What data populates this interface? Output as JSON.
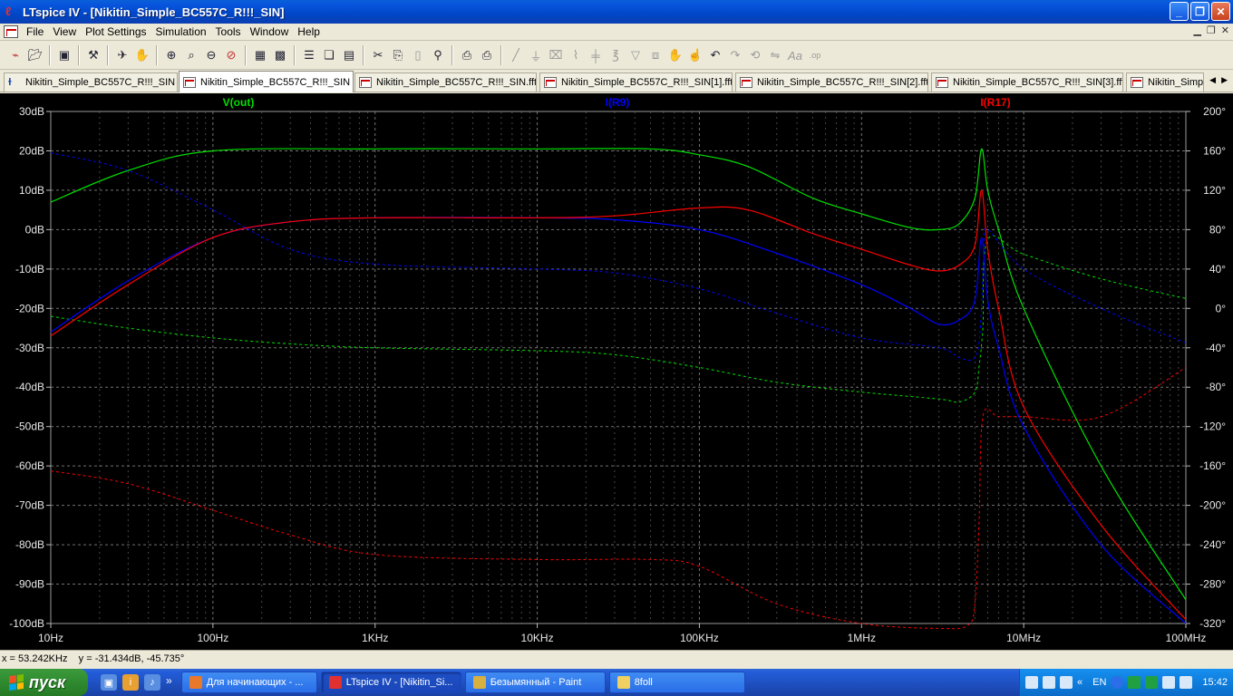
{
  "window": {
    "title": "LTspice IV - [Nikitin_Simple_BC557C_R!!!_SIN]",
    "minimize": "_",
    "maximize": "❐",
    "close": "✕"
  },
  "menu": [
    "File",
    "View",
    "Plot Settings",
    "Simulation",
    "Tools",
    "Window",
    "Help"
  ],
  "tabs": [
    {
      "label": "Nikitin_Simple_BC557C_R!!!_SIN",
      "type": "schematic",
      "active": false
    },
    {
      "label": "Nikitin_Simple_BC557C_R!!!_SIN",
      "type": "plot",
      "active": true
    },
    {
      "label": "Nikitin_Simple_BC557C_R!!!_SIN.fft",
      "type": "plot",
      "active": false
    },
    {
      "label": "Nikitin_Simple_BC557C_R!!!_SIN[1].fft",
      "type": "plot",
      "active": false
    },
    {
      "label": "Nikitin_Simple_BC557C_R!!!_SIN[2].fft",
      "type": "plot",
      "active": false
    },
    {
      "label": "Nikitin_Simple_BC557C_R!!!_SIN[3].fft",
      "type": "plot",
      "active": false
    },
    {
      "label": "Nikitin_Simp",
      "type": "plot",
      "active": false
    }
  ],
  "chart_data": {
    "type": "line",
    "xscale": "log",
    "xlim": [
      10,
      100000000
    ],
    "x_ticks": [
      {
        "v": 10,
        "label": "10Hz"
      },
      {
        "v": 100,
        "label": "100Hz"
      },
      {
        "v": 1000,
        "label": "1KHz"
      },
      {
        "v": 10000,
        "label": "10KHz"
      },
      {
        "v": 100000,
        "label": "100KHz"
      },
      {
        "v": 1000000,
        "label": "1MHz"
      },
      {
        "v": 10000000,
        "label": "10MHz"
      },
      {
        "v": 100000000,
        "label": "100MHz"
      }
    ],
    "ylim": [
      -100,
      30
    ],
    "y_ticks": [
      "30dB",
      "20dB",
      "10dB",
      "0dB",
      "-10dB",
      "-20dB",
      "-30dB",
      "-40dB",
      "-50dB",
      "-60dB",
      "-70dB",
      "-80dB",
      "-90dB",
      "-100dB"
    ],
    "y2lim": [
      -320,
      200
    ],
    "y2_ticks": [
      "200°",
      "160°",
      "120°",
      "80°",
      "40°",
      "0°",
      "-40°",
      "-80°",
      "-120°",
      "-160°",
      "-200°",
      "-240°",
      "-280°",
      "-320°"
    ],
    "grid": true,
    "legend_position": "top",
    "series": [
      {
        "name": "V(out)",
        "color": "#00e000",
        "magnitude": [
          [
            10,
            7
          ],
          [
            30,
            15
          ],
          [
            100,
            20
          ],
          [
            1000,
            20.5
          ],
          [
            10000,
            20.5
          ],
          [
            50000,
            20.5
          ],
          [
            100000,
            19
          ],
          [
            200000,
            16
          ],
          [
            500000,
            8
          ],
          [
            1000000,
            4
          ],
          [
            2000000,
            0.5
          ],
          [
            3000000,
            0
          ],
          [
            4000000,
            1.5
          ],
          [
            5000000,
            8
          ],
          [
            5500000,
            20.5
          ],
          [
            6000000,
            10
          ],
          [
            7000000,
            0
          ],
          [
            10000000,
            -20
          ],
          [
            30000000,
            -60
          ],
          [
            100000000,
            -94
          ]
        ],
        "phase": [
          [
            10,
            -8
          ],
          [
            30,
            -20
          ],
          [
            100,
            -30
          ],
          [
            300,
            -36
          ],
          [
            1000,
            -40
          ],
          [
            10000,
            -43
          ],
          [
            30000,
            -47
          ],
          [
            100000,
            -60
          ],
          [
            300000,
            -75
          ],
          [
            1000000,
            -85
          ],
          [
            3000000,
            -92
          ],
          [
            4000000,
            -95
          ],
          [
            5000000,
            -85
          ],
          [
            5300000,
            -60
          ],
          [
            5600000,
            -20
          ],
          [
            6000000,
            70
          ],
          [
            10000000,
            55
          ],
          [
            30000000,
            30
          ],
          [
            100000000,
            10
          ]
        ]
      },
      {
        "name": "I(R9)",
        "color": "#0000ff",
        "magnitude": [
          [
            10,
            -26
          ],
          [
            30,
            -13
          ],
          [
            100,
            -2
          ],
          [
            300,
            2
          ],
          [
            1000,
            3
          ],
          [
            10000,
            3
          ],
          [
            30000,
            2.5
          ],
          [
            100000,
            0
          ],
          [
            300000,
            -6
          ],
          [
            1000000,
            -14
          ],
          [
            2000000,
            -20
          ],
          [
            3000000,
            -24
          ],
          [
            4000000,
            -23
          ],
          [
            5000000,
            -18
          ],
          [
            5500000,
            -2
          ],
          [
            6000000,
            -18
          ],
          [
            7000000,
            -30
          ],
          [
            10000000,
            -50
          ],
          [
            30000000,
            -80
          ],
          [
            100000000,
            -100
          ]
        ],
        "phase": [
          [
            10,
            158
          ],
          [
            30,
            140
          ],
          [
            100,
            100
          ],
          [
            300,
            60
          ],
          [
            1000,
            45
          ],
          [
            10000,
            40
          ],
          [
            30000,
            36
          ],
          [
            100000,
            20
          ],
          [
            300000,
            -5
          ],
          [
            1000000,
            -30
          ],
          [
            3000000,
            -40
          ],
          [
            4000000,
            -50
          ],
          [
            5000000,
            -50
          ],
          [
            5400000,
            -20
          ],
          [
            5700000,
            60
          ],
          [
            6000000,
            80
          ],
          [
            10000000,
            40
          ],
          [
            30000000,
            0
          ],
          [
            100000000,
            -35
          ]
        ]
      },
      {
        "name": "I(R17)",
        "color": "#ff0000",
        "magnitude": [
          [
            10,
            -27
          ],
          [
            30,
            -14
          ],
          [
            100,
            -2
          ],
          [
            300,
            2
          ],
          [
            1000,
            3
          ],
          [
            10000,
            3
          ],
          [
            30000,
            3.5
          ],
          [
            100000,
            5.5
          ],
          [
            200000,
            5
          ],
          [
            500000,
            -1
          ],
          [
            1000000,
            -5
          ],
          [
            2000000,
            -9
          ],
          [
            3000000,
            -10.5
          ],
          [
            4000000,
            -9
          ],
          [
            5000000,
            -4
          ],
          [
            5500000,
            10
          ],
          [
            6000000,
            -5
          ],
          [
            7000000,
            -20
          ],
          [
            10000000,
            -45
          ],
          [
            30000000,
            -75
          ],
          [
            100000000,
            -99
          ]
        ],
        "phase": [
          [
            10,
            -165
          ],
          [
            30,
            -178
          ],
          [
            100,
            -205
          ],
          [
            300,
            -230
          ],
          [
            1000,
            -250
          ],
          [
            10000,
            -255
          ],
          [
            50000,
            -255
          ],
          [
            100000,
            -262
          ],
          [
            300000,
            -300
          ],
          [
            1000000,
            -320
          ],
          [
            3000000,
            -325
          ],
          [
            4500000,
            -322
          ],
          [
            5000000,
            -300
          ],
          [
            5300000,
            -220
          ],
          [
            5600000,
            -110
          ],
          [
            7000000,
            -110
          ],
          [
            10000000,
            -110
          ],
          [
            30000000,
            -110
          ],
          [
            100000000,
            -60
          ]
        ]
      }
    ]
  },
  "status": {
    "readout": "x = 53.242KHz    y = -31.434dB, -45.735°"
  },
  "taskbar": {
    "start_label": "пуск",
    "buttons": [
      {
        "label": "Для начинающих - ...",
        "active": false,
        "icon_color": "#e8782a"
      },
      {
        "label": "LTspice IV - [Nikitin_Si...",
        "active": true,
        "icon_color": "#e03030"
      },
      {
        "label": "Безымянный - Paint",
        "active": false,
        "icon_color": "#d8b040"
      },
      {
        "label": "8foll",
        "active": false,
        "icon_color": "#f0d060"
      }
    ],
    "lang": "EN",
    "clock": "15:42"
  }
}
